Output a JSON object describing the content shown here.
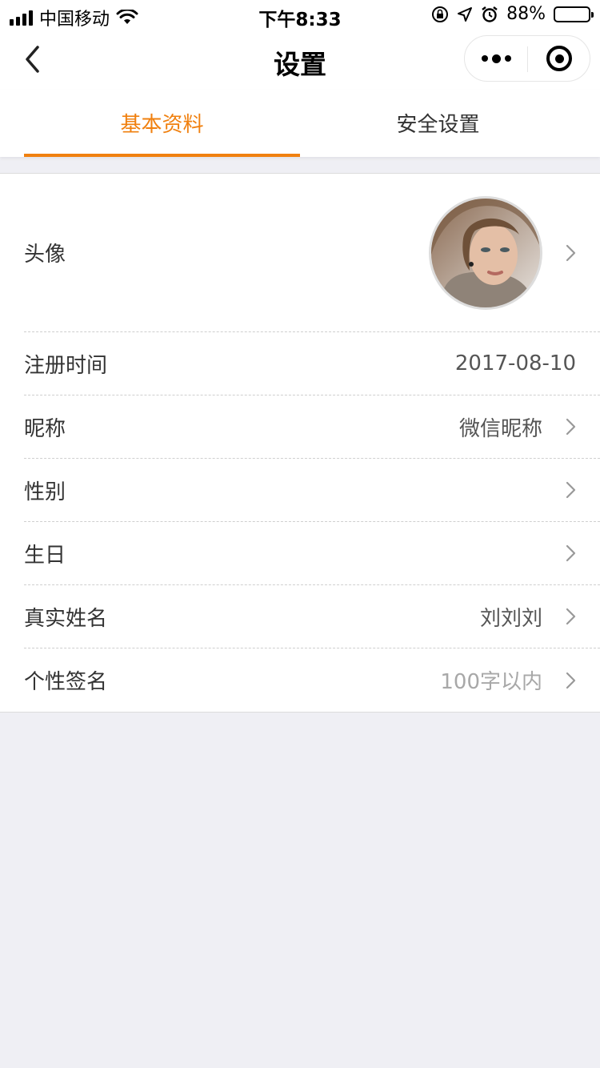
{
  "status_bar": {
    "carrier": "中国移动",
    "time": "下午8:33",
    "battery_text": "88%",
    "battery_level": 0.88,
    "icons": [
      "signal-icon",
      "wifi-icon",
      "rotation-lock-icon",
      "location-icon",
      "alarm-icon",
      "battery-icon"
    ]
  },
  "nav": {
    "title": "设置",
    "back_icon": "chevron-left-icon",
    "more_icon": "more-icon",
    "close_icon": "target-close-icon"
  },
  "tabs": [
    {
      "label": "基本资料",
      "active": true
    },
    {
      "label": "安全设置",
      "active": false
    }
  ],
  "rows": [
    {
      "label": "头像",
      "value": "",
      "chevron": true
    },
    {
      "label": "注册时间",
      "value": "2017-08-10",
      "chevron": false
    },
    {
      "label": "昵称",
      "value": "微信昵称",
      "chevron": true
    },
    {
      "label": "性别",
      "value": "",
      "chevron": true
    },
    {
      "label": "生日",
      "value": "",
      "chevron": true
    },
    {
      "label": "真实姓名",
      "value": "刘刘刘",
      "chevron": true
    },
    {
      "label": "个性签名",
      "value": "100字以内",
      "chevron": true
    }
  ],
  "colors": {
    "accent": "#f0800f",
    "background": "#efeff4",
    "text": "#333333",
    "placeholder": "#a8a8a8"
  }
}
